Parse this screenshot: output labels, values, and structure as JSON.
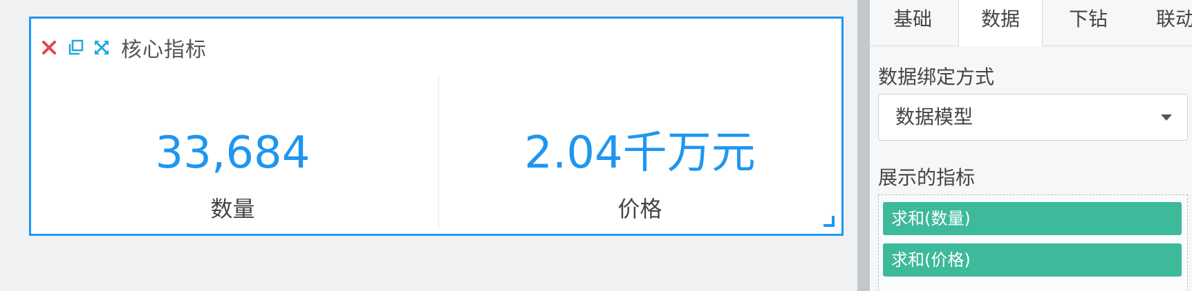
{
  "widget": {
    "title": "核心指标",
    "icons": [
      "close-icon",
      "copy-icon",
      "fullscreen-icon"
    ],
    "metrics": [
      {
        "value": "33,684",
        "label": "数量"
      },
      {
        "value": "2.04千万元",
        "label": "价格"
      }
    ]
  },
  "panel": {
    "tabs": [
      "基础",
      "数据",
      "下钻",
      "联动"
    ],
    "active_tab": "数据",
    "binding_label": "数据绑定方式",
    "binding_value": "数据模型",
    "indicators_label": "展示的指标",
    "indicators": [
      "求和(数量)",
      "求和(价格)"
    ]
  },
  "colors": {
    "accent": "#1e96f0",
    "close": "#e84545",
    "pill": "#3db99b"
  }
}
